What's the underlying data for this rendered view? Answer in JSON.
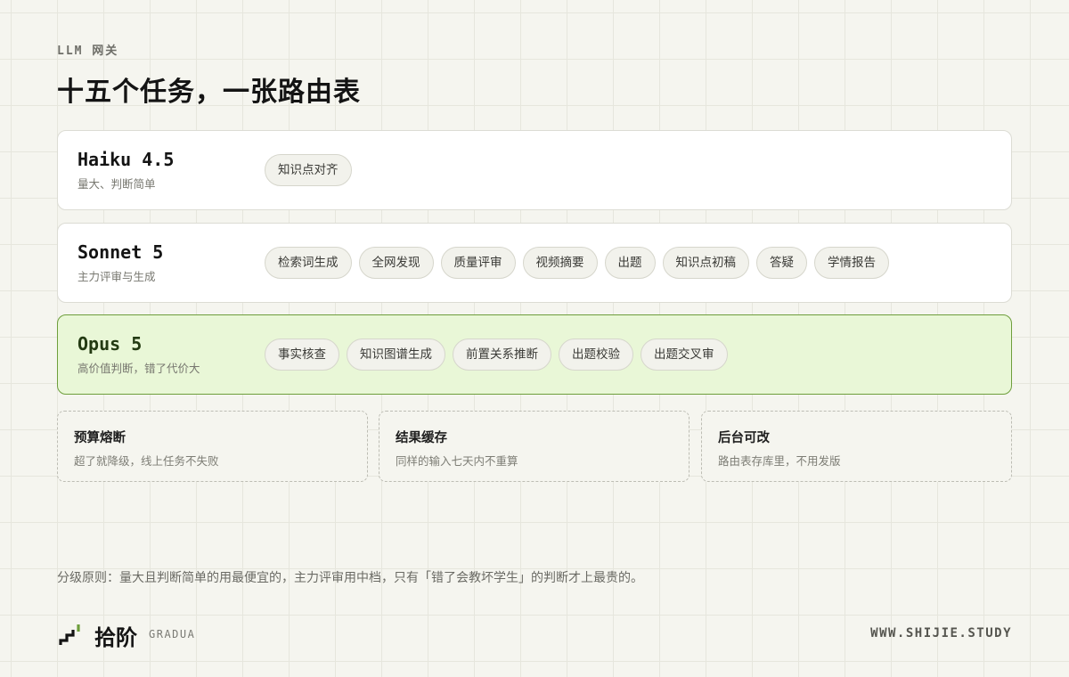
{
  "header": {
    "eyebrow": "LLM 网关",
    "title": "十五个任务，一张路由表"
  },
  "tiers": [
    {
      "name": "Haiku 4.5",
      "desc": "量大、判断简单",
      "highlight": false,
      "tasks": [
        "知识点对齐"
      ]
    },
    {
      "name": "Sonnet 5",
      "desc": "主力评审与生成",
      "highlight": false,
      "tasks": [
        "检索词生成",
        "全网发现",
        "质量评审",
        "视频摘要",
        "出题",
        "知识点初稿",
        "答疑",
        "学情报告"
      ]
    },
    {
      "name": "Opus 5",
      "desc": "高价值判断，错了代价大",
      "highlight": true,
      "tasks": [
        "事实核查",
        "知识图谱生成",
        "前置关系推断",
        "出题校验",
        "出题交叉审"
      ]
    }
  ],
  "features": [
    {
      "title": "预算熔断",
      "desc": "超了就降级，线上任务不失败"
    },
    {
      "title": "结果缓存",
      "desc": "同样的输入七天内不重算"
    },
    {
      "title": "后台可改",
      "desc": "路由表存库里，不用发版"
    }
  ],
  "principle": "分级原则：量大且判断简单的用最便宜的，主力评审用中档，只有「错了会教坏学生」的判断才上最贵的。",
  "footer": {
    "brand": "拾阶",
    "brand_sub": "GRADUA",
    "site": "WWW.SHIJIE.STUDY",
    "logo_icon": "stairs-icon"
  },
  "colors": {
    "accent_green": "#6e9e3c",
    "highlight_bg": "#e9f7d7"
  }
}
